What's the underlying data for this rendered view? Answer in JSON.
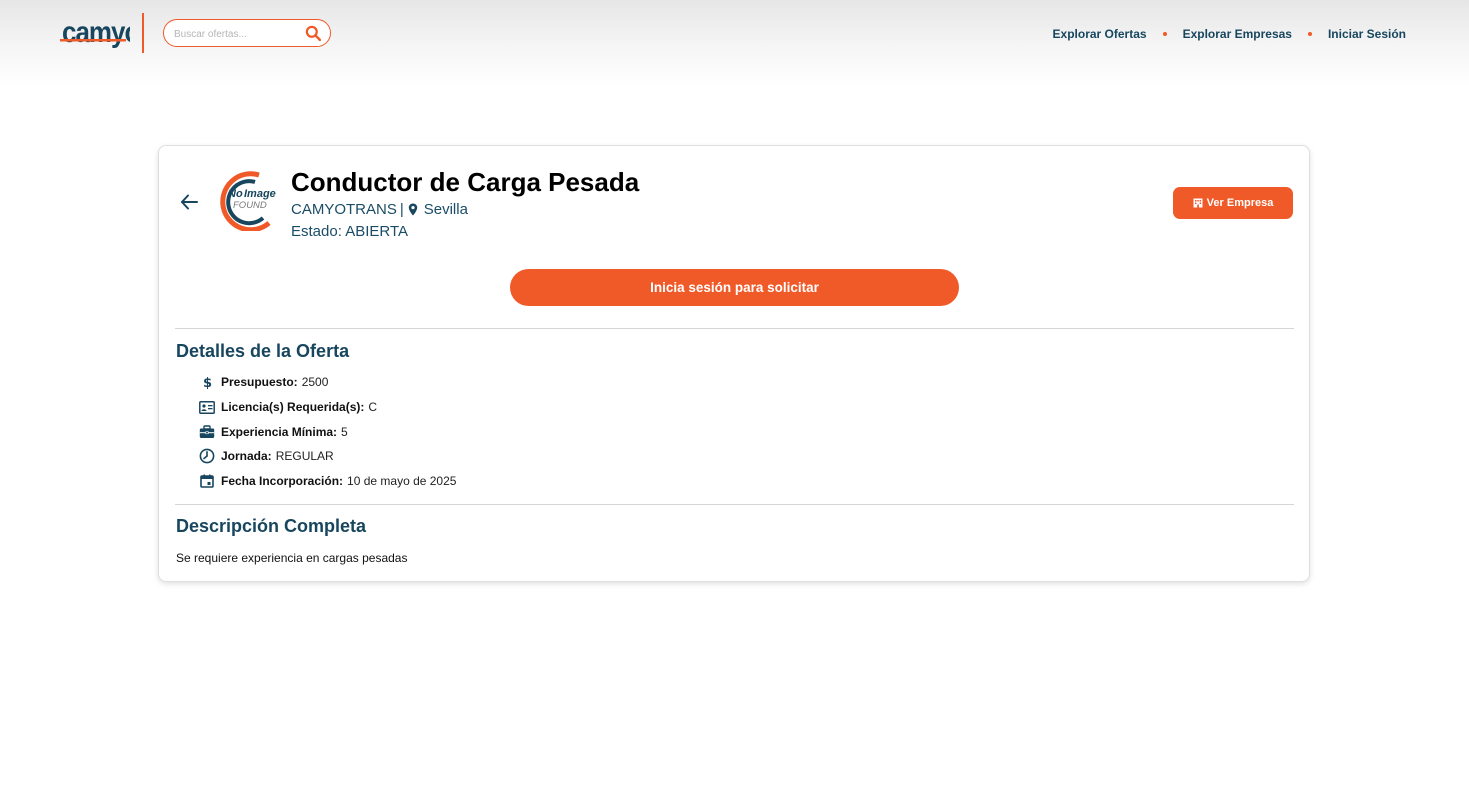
{
  "header": {
    "search": {
      "placeholder": "Buscar ofertas..."
    },
    "nav": {
      "explore_offers": "Explorar Ofertas",
      "explore_companies": "Explorar Empresas",
      "login": "Iniciar Sesión"
    }
  },
  "offer": {
    "title": "Conductor de Carga Pesada",
    "company": "CAMYOTRANS",
    "separator": "|",
    "location": "Sevilla",
    "status": "Estado: ABIERTA",
    "view_company_label": "Ver Empresa",
    "apply_label": "Inicia sesión para solicitar",
    "details_heading": "Detalles de la Oferta",
    "details": [
      {
        "icon": "dollar-icon",
        "label": "Presupuesto:",
        "value": "2500"
      },
      {
        "icon": "id-card-icon",
        "label": "Licencia(s) Requerida(s):",
        "value": "C"
      },
      {
        "icon": "briefcase-icon",
        "label": "Experiencia Mínima:",
        "value": "5"
      },
      {
        "icon": "clock-icon",
        "label": "Jornada:",
        "value": "REGULAR"
      },
      {
        "icon": "calendar-icon",
        "label": "Fecha Incorporación:",
        "value": "10 de mayo de 2025"
      }
    ],
    "description_heading": "Descripción Completa",
    "description": "Se requiere experiencia en cargas pesadas"
  },
  "colors": {
    "accent": "#f05a28",
    "primary_text": "#17465e"
  }
}
